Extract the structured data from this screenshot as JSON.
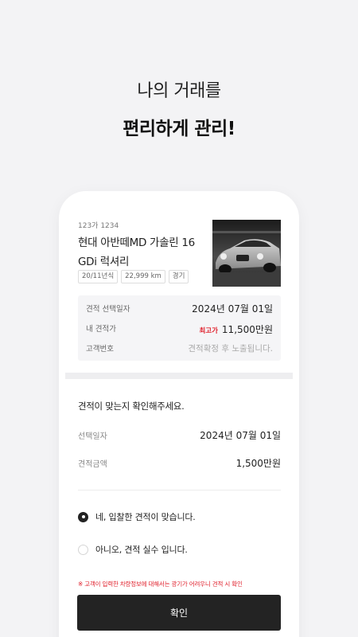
{
  "promo": {
    "line1": "나의 거래를",
    "line2": "편리하게 관리!"
  },
  "vehicle": {
    "plate": "123가 1234",
    "name": "현대 아반떼MD 가솔린 16 GDi 럭셔리",
    "tags": [
      "20/11년식",
      "22,999 km",
      "경기"
    ],
    "image_icon": "car-photo"
  },
  "quote_info": {
    "rows": [
      {
        "label": "견적 선택일자",
        "value": "2024년 07월 01일"
      },
      {
        "label": "내 견적가",
        "badge": "최고가",
        "value": "11,500만원"
      },
      {
        "label": "고객번호",
        "value": "견적확정 후 노출됩니다."
      }
    ]
  },
  "confirm": {
    "title": "견적이 맞는지 확인해주세요.",
    "date_label": "선택일자",
    "date_value": "2024년 07월 01일",
    "amount_label": "견적금액",
    "amount_value": "1,500만원",
    "options": [
      {
        "label": "네, 입찰한 견적이 맞습니다.",
        "selected": true
      },
      {
        "label": "아니오, 견적 실수 입니다.",
        "selected": false
      }
    ],
    "warning": "※ 고객이 입력한 차량정보에 대해서는 광기가 어려우니 견적 시 확인",
    "button_label": "확인"
  },
  "colors": {
    "accent_red": "#e0202c",
    "button_bg": "#232323",
    "page_bg": "#f3f3f5"
  }
}
